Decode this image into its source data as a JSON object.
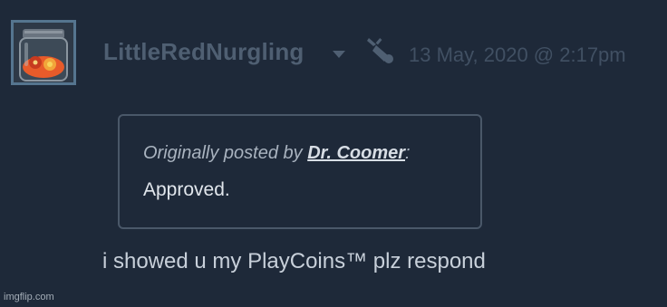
{
  "comment": {
    "author_name": "LittleRedNurgling",
    "timestamp": "13 May, 2020 @ 2:17pm",
    "text": "i showed u my PlayCoins™ plz respond"
  },
  "quote": {
    "prefix": "Originally posted by ",
    "author": "Dr. Coomer",
    "suffix": ":",
    "text": "Approved."
  },
  "icons": {
    "avatar": "jar-avatar-image",
    "dropdown": "chevron-down-icon",
    "device": "device-icon"
  },
  "colors": {
    "background": "#1e2939",
    "username": "#4f5f72",
    "timestamp": "#415063",
    "quote_border": "#4a5869",
    "comment_text": "#c8d0da"
  },
  "watermark": "imgflip.com"
}
